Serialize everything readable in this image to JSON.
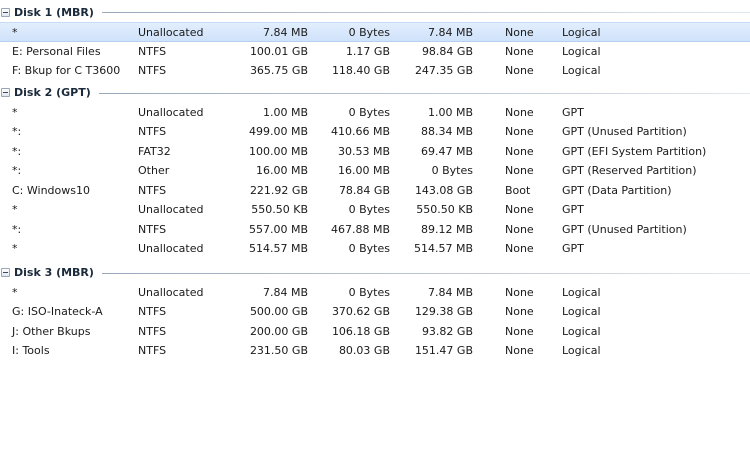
{
  "disks": [
    {
      "title": "Disk 1 (MBR)",
      "rows": [
        {
          "volume": "*",
          "fs": "Unallocated",
          "capacity": "7.84 MB",
          "used": "0 Bytes",
          "free": "7.84 MB",
          "boot": "None",
          "type": "Logical",
          "selected": true
        },
        {
          "volume": "E: Personal Files",
          "fs": "NTFS",
          "capacity": "100.01 GB",
          "used": "1.17 GB",
          "free": "98.84 GB",
          "boot": "None",
          "type": "Logical"
        },
        {
          "volume": "F: Bkup for C T3600",
          "fs": "NTFS",
          "capacity": "365.75 GB",
          "used": "118.40 GB",
          "free": "247.35 GB",
          "boot": "None",
          "type": "Logical"
        }
      ]
    },
    {
      "title": "Disk 2 (GPT)",
      "rows": [
        {
          "volume": "*",
          "fs": "Unallocated",
          "capacity": "1.00 MB",
          "used": "0 Bytes",
          "free": "1.00 MB",
          "boot": "None",
          "type": "GPT"
        },
        {
          "volume": "*:",
          "fs": "NTFS",
          "capacity": "499.00 MB",
          "used": "410.66 MB",
          "free": "88.34 MB",
          "boot": "None",
          "type": "GPT (Unused Partition)"
        },
        {
          "volume": "*:",
          "fs": "FAT32",
          "capacity": "100.00 MB",
          "used": "30.53 MB",
          "free": "69.47 MB",
          "boot": "None",
          "type": "GPT (EFI System Partition)"
        },
        {
          "volume": "*:",
          "fs": "Other",
          "capacity": "16.00 MB",
          "used": "16.00 MB",
          "free": "0 Bytes",
          "boot": "None",
          "type": "GPT (Reserved Partition)"
        },
        {
          "volume": "C: Windows10",
          "fs": "NTFS",
          "capacity": "221.92 GB",
          "used": "78.84 GB",
          "free": "143.08 GB",
          "boot": "Boot",
          "type": "GPT (Data Partition)"
        },
        {
          "volume": "*",
          "fs": "Unallocated",
          "capacity": "550.50 KB",
          "used": "0 Bytes",
          "free": "550.50 KB",
          "boot": "None",
          "type": "GPT"
        },
        {
          "volume": "*:",
          "fs": "NTFS",
          "capacity": "557.00 MB",
          "used": "467.88 MB",
          "free": "89.12 MB",
          "boot": "None",
          "type": "GPT (Unused Partition)"
        },
        {
          "volume": "*",
          "fs": "Unallocated",
          "capacity": "514.57 MB",
          "used": "0 Bytes",
          "free": "514.57 MB",
          "boot": "None",
          "type": "GPT"
        }
      ]
    },
    {
      "title": "Disk 3 (MBR)",
      "rows": [
        {
          "volume": "*",
          "fs": "Unallocated",
          "capacity": "7.84 MB",
          "used": "0 Bytes",
          "free": "7.84 MB",
          "boot": "None",
          "type": "Logical"
        },
        {
          "volume": "G: ISO-Inateck-A",
          "fs": "NTFS",
          "capacity": "500.00 GB",
          "used": "370.62 GB",
          "free": "129.38 GB",
          "boot": "None",
          "type": "Logical"
        },
        {
          "volume": "J: Other Bkups",
          "fs": "NTFS",
          "capacity": "200.00 GB",
          "used": "106.18 GB",
          "free": "93.82 GB",
          "boot": "None",
          "type": "Logical"
        },
        {
          "volume": "I: Tools",
          "fs": "NTFS",
          "capacity": "231.50 GB",
          "used": "80.03 GB",
          "free": "151.47 GB",
          "boot": "None",
          "type": "Logical"
        }
      ]
    }
  ]
}
